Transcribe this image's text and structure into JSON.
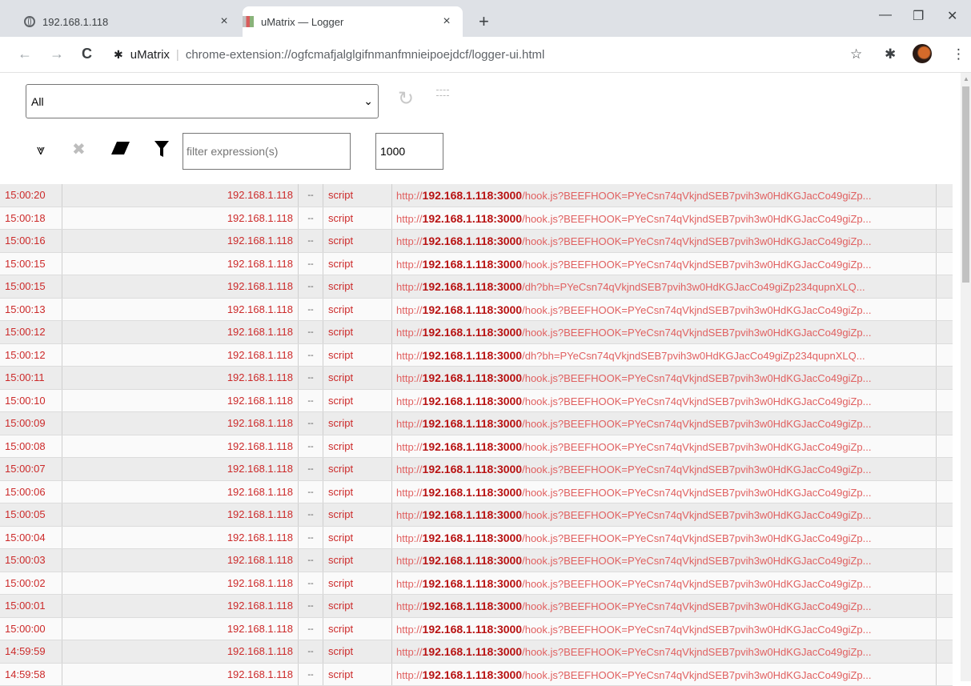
{
  "tabs": [
    {
      "title": "192.168.1.118",
      "close": "×",
      "icon": "globe-icon",
      "active": false
    },
    {
      "title": "uMatrix — Logger",
      "close": "×",
      "icon": "umatrix-icon",
      "active": true
    }
  ],
  "new_tab": "+",
  "window": {
    "minimize": "—",
    "restore": "❐",
    "close": "✕"
  },
  "toolbar": {
    "back": "←",
    "forward": "→",
    "reload": "C",
    "site_name": "uMatrix",
    "separator": "|",
    "url": "chrome-extension://ogfcmafjalglgifnmanfmnieipoejdcf/logger-ui.html",
    "star": "☆",
    "extensions": "✱",
    "menu": "⋮"
  },
  "logger": {
    "tab_select": "All",
    "filter_placeholder": "filter expression(s)",
    "max_entries": "1000"
  },
  "rows": [
    {
      "time": "15:00:20",
      "host": "192.168.1.118",
      "dash": "--",
      "type": "script",
      "scheme": "http://",
      "host_port": "192.168.1.118:3000",
      "path": "/hook.js?BEEFHOOK=PYeCsn74qVkjndSEB7pvih3w0HdKGJacCo49giZp..."
    },
    {
      "time": "15:00:18",
      "host": "192.168.1.118",
      "dash": "--",
      "type": "script",
      "scheme": "http://",
      "host_port": "192.168.1.118:3000",
      "path": "/hook.js?BEEFHOOK=PYeCsn74qVkjndSEB7pvih3w0HdKGJacCo49giZp..."
    },
    {
      "time": "15:00:16",
      "host": "192.168.1.118",
      "dash": "--",
      "type": "script",
      "scheme": "http://",
      "host_port": "192.168.1.118:3000",
      "path": "/hook.js?BEEFHOOK=PYeCsn74qVkjndSEB7pvih3w0HdKGJacCo49giZp..."
    },
    {
      "time": "15:00:15",
      "host": "192.168.1.118",
      "dash": "--",
      "type": "script",
      "scheme": "http://",
      "host_port": "192.168.1.118:3000",
      "path": "/hook.js?BEEFHOOK=PYeCsn74qVkjndSEB7pvih3w0HdKGJacCo49giZp..."
    },
    {
      "time": "15:00:15",
      "host": "192.168.1.118",
      "dash": "--",
      "type": "script",
      "scheme": "http://",
      "host_port": "192.168.1.118:3000",
      "path": "/dh?bh=PYeCsn74qVkjndSEB7pvih3w0HdKGJacCo49giZp234qupnXLQ..."
    },
    {
      "time": "15:00:13",
      "host": "192.168.1.118",
      "dash": "--",
      "type": "script",
      "scheme": "http://",
      "host_port": "192.168.1.118:3000",
      "path": "/hook.js?BEEFHOOK=PYeCsn74qVkjndSEB7pvih3w0HdKGJacCo49giZp..."
    },
    {
      "time": "15:00:12",
      "host": "192.168.1.118",
      "dash": "--",
      "type": "script",
      "scheme": "http://",
      "host_port": "192.168.1.118:3000",
      "path": "/hook.js?BEEFHOOK=PYeCsn74qVkjndSEB7pvih3w0HdKGJacCo49giZp..."
    },
    {
      "time": "15:00:12",
      "host": "192.168.1.118",
      "dash": "--",
      "type": "script",
      "scheme": "http://",
      "host_port": "192.168.1.118:3000",
      "path": "/dh?bh=PYeCsn74qVkjndSEB7pvih3w0HdKGJacCo49giZp234qupnXLQ..."
    },
    {
      "time": "15:00:11",
      "host": "192.168.1.118",
      "dash": "--",
      "type": "script",
      "scheme": "http://",
      "host_port": "192.168.1.118:3000",
      "path": "/hook.js?BEEFHOOK=PYeCsn74qVkjndSEB7pvih3w0HdKGJacCo49giZp..."
    },
    {
      "time": "15:00:10",
      "host": "192.168.1.118",
      "dash": "--",
      "type": "script",
      "scheme": "http://",
      "host_port": "192.168.1.118:3000",
      "path": "/hook.js?BEEFHOOK=PYeCsn74qVkjndSEB7pvih3w0HdKGJacCo49giZp..."
    },
    {
      "time": "15:00:09",
      "host": "192.168.1.118",
      "dash": "--",
      "type": "script",
      "scheme": "http://",
      "host_port": "192.168.1.118:3000",
      "path": "/hook.js?BEEFHOOK=PYeCsn74qVkjndSEB7pvih3w0HdKGJacCo49giZp..."
    },
    {
      "time": "15:00:08",
      "host": "192.168.1.118",
      "dash": "--",
      "type": "script",
      "scheme": "http://",
      "host_port": "192.168.1.118:3000",
      "path": "/hook.js?BEEFHOOK=PYeCsn74qVkjndSEB7pvih3w0HdKGJacCo49giZp..."
    },
    {
      "time": "15:00:07",
      "host": "192.168.1.118",
      "dash": "--",
      "type": "script",
      "scheme": "http://",
      "host_port": "192.168.1.118:3000",
      "path": "/hook.js?BEEFHOOK=PYeCsn74qVkjndSEB7pvih3w0HdKGJacCo49giZp..."
    },
    {
      "time": "15:00:06",
      "host": "192.168.1.118",
      "dash": "--",
      "type": "script",
      "scheme": "http://",
      "host_port": "192.168.1.118:3000",
      "path": "/hook.js?BEEFHOOK=PYeCsn74qVkjndSEB7pvih3w0HdKGJacCo49giZp..."
    },
    {
      "time": "15:00:05",
      "host": "192.168.1.118",
      "dash": "--",
      "type": "script",
      "scheme": "http://",
      "host_port": "192.168.1.118:3000",
      "path": "/hook.js?BEEFHOOK=PYeCsn74qVkjndSEB7pvih3w0HdKGJacCo49giZp..."
    },
    {
      "time": "15:00:04",
      "host": "192.168.1.118",
      "dash": "--",
      "type": "script",
      "scheme": "http://",
      "host_port": "192.168.1.118:3000",
      "path": "/hook.js?BEEFHOOK=PYeCsn74qVkjndSEB7pvih3w0HdKGJacCo49giZp..."
    },
    {
      "time": "15:00:03",
      "host": "192.168.1.118",
      "dash": "--",
      "type": "script",
      "scheme": "http://",
      "host_port": "192.168.1.118:3000",
      "path": "/hook.js?BEEFHOOK=PYeCsn74qVkjndSEB7pvih3w0HdKGJacCo49giZp..."
    },
    {
      "time": "15:00:02",
      "host": "192.168.1.118",
      "dash": "--",
      "type": "script",
      "scheme": "http://",
      "host_port": "192.168.1.118:3000",
      "path": "/hook.js?BEEFHOOK=PYeCsn74qVkjndSEB7pvih3w0HdKGJacCo49giZp..."
    },
    {
      "time": "15:00:01",
      "host": "192.168.1.118",
      "dash": "--",
      "type": "script",
      "scheme": "http://",
      "host_port": "192.168.1.118:3000",
      "path": "/hook.js?BEEFHOOK=PYeCsn74qVkjndSEB7pvih3w0HdKGJacCo49giZp..."
    },
    {
      "time": "15:00:00",
      "host": "192.168.1.118",
      "dash": "--",
      "type": "script",
      "scheme": "http://",
      "host_port": "192.168.1.118:3000",
      "path": "/hook.js?BEEFHOOK=PYeCsn74qVkjndSEB7pvih3w0HdKGJacCo49giZp..."
    },
    {
      "time": "14:59:59",
      "host": "192.168.1.118",
      "dash": "--",
      "type": "script",
      "scheme": "http://",
      "host_port": "192.168.1.118:3000",
      "path": "/hook.js?BEEFHOOK=PYeCsn74qVkjndSEB7pvih3w0HdKGJacCo49giZp..."
    },
    {
      "time": "14:59:58",
      "host": "192.168.1.118",
      "dash": "--",
      "type": "script",
      "scheme": "http://",
      "host_port": "192.168.1.118:3000",
      "path": "/hook.js?BEEFHOOK=PYeCsn74qVkjndSEB7pvih3w0HdKGJacCo49giZp..."
    }
  ]
}
